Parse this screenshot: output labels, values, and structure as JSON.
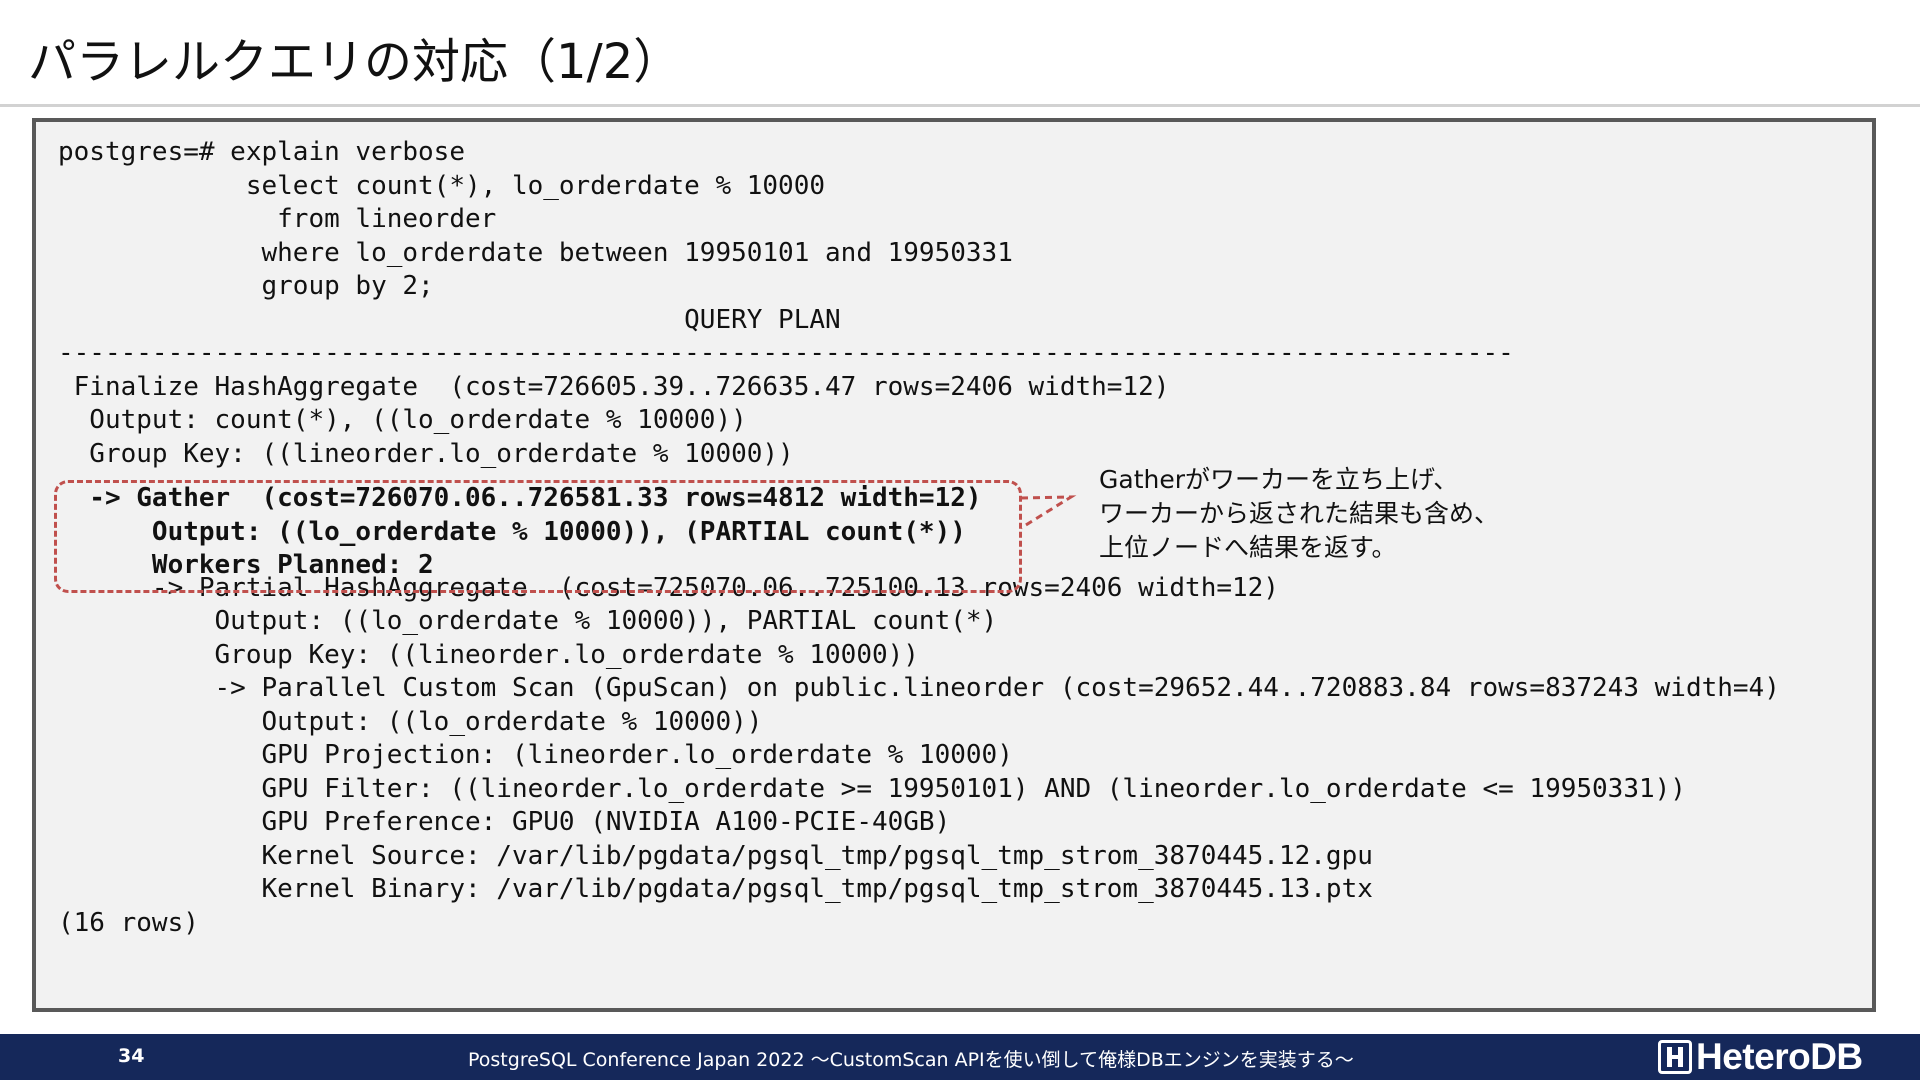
{
  "title": "パラレルクエリの対応（1/2）",
  "code": {
    "lines_before": [
      "postgres=# explain verbose",
      "            select count(*), lo_orderdate % 10000",
      "              from lineorder",
      "             where lo_orderdate between 19950101 and 19950331",
      "             group by 2;",
      "                                        QUERY PLAN",
      "---------------------------------------------------------------------------------------------",
      " Finalize HashAggregate  (cost=726605.39..726635.47 rows=2406 width=12)",
      "  Output: count(*), ((lo_orderdate % 10000))",
      "  Group Key: ((lineorder.lo_orderdate % 10000))"
    ],
    "lines_highlight": [
      "  -> Gather  (cost=726070.06..726581.33 rows=4812 width=12)",
      "      Output: ((lo_orderdate % 10000)), (PARTIAL count(*))",
      "      Workers Planned: 2"
    ],
    "lines_after": [
      "      -> Partial HashAggregate  (cost=725070.06..725100.13 rows=2406 width=12)",
      "          Output: ((lo_orderdate % 10000)), PARTIAL count(*)",
      "          Group Key: ((lineorder.lo_orderdate % 10000))",
      "          -> Parallel Custom Scan (GpuScan) on public.lineorder (cost=29652.44..720883.84 rows=837243 width=4)",
      "             Output: ((lo_orderdate % 10000))",
      "             GPU Projection: (lineorder.lo_orderdate % 10000)",
      "             GPU Filter: ((lineorder.lo_orderdate >= 19950101) AND (lineorder.lo_orderdate <= 19950331))",
      "             GPU Preference: GPU0 (NVIDIA A100-PCIE-40GB)",
      "             Kernel Source: /var/lib/pgdata/pgsql_tmp/pgsql_tmp_strom_3870445.12.gpu",
      "             Kernel Binary: /var/lib/pgdata/pgsql_tmp/pgsql_tmp_strom_3870445.13.ptx",
      "(16 rows)"
    ]
  },
  "callout": {
    "lines": [
      "Gatherがワーカーを立ち上げ、",
      "ワーカーから返された結果も含め、",
      "上位ノードへ結果を返す。"
    ]
  },
  "footer": {
    "page_number": "34",
    "conference": "PostgreSQL Conference Japan 2022 ～CustomScan APIを使い倒して俺様DBエンジンを実装する～",
    "logo": "HeteroDB"
  },
  "colors": {
    "footer_bg": "#15285a",
    "highlight_border": "#c0504d",
    "code_bg": "#f2f2f2",
    "panel_border": "#595959"
  }
}
